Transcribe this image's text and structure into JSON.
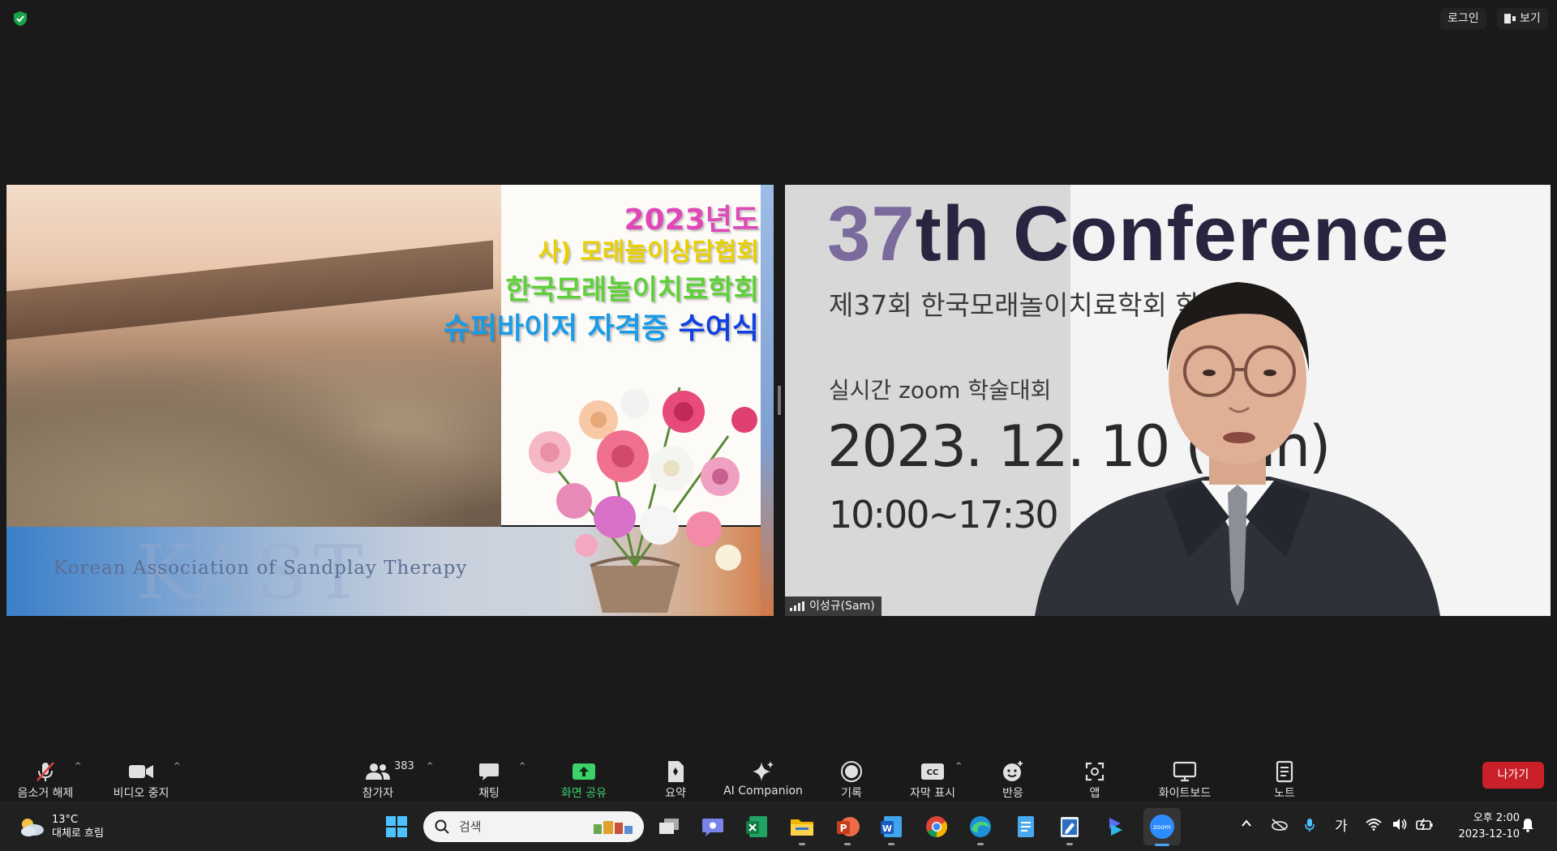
{
  "topbar": {
    "login_label": "로그인",
    "view_label": "보기"
  },
  "share_slide": {
    "line1": "2023년도",
    "line2": "사) 모래놀이상담협회",
    "line3": "한국모래놀이치료학회",
    "line4_part1": "슈퍼바이저 자격증 ",
    "line4_part2": "수여식",
    "watermark_big": "KAST",
    "watermark_sub": "Korean Association of Sandplay Therapy"
  },
  "participant_video": {
    "conf_num": "37",
    "conf_rest": "th Conference",
    "conf_subtitle": "제37회 한국모래놀이치료학회 학술대회",
    "live_label": "실시간 zoom 학술대회",
    "date": "2023. 12. 10 (Sun)",
    "time": "10:00~17:30",
    "name_tag": "이성규(Sam)"
  },
  "controls": {
    "unmute_label": "음소거 해제",
    "video_label": "비디오 중지",
    "participants_label": "참가자",
    "participants_count": "383",
    "chat_label": "채팅",
    "share_label": "화면 공유",
    "summary_label": "요약",
    "ai_label": "AI Companion",
    "record_label": "기록",
    "cc_label": "자막 표시",
    "reactions_label": "반응",
    "apps_label": "앱",
    "whiteboard_label": "화이트보드",
    "notes_label": "노트",
    "leave_label": "나가기"
  },
  "taskbar": {
    "temperature": "13°C",
    "weather_desc": "대체로 흐림",
    "search_placeholder": "검색",
    "ime_label": "가",
    "time": "오후 2:00",
    "date": "2023-12-10"
  },
  "colors": {
    "share_green": "#3dd16a",
    "leave_red": "#c9202a",
    "zoom_blue": "#2d8cff"
  }
}
